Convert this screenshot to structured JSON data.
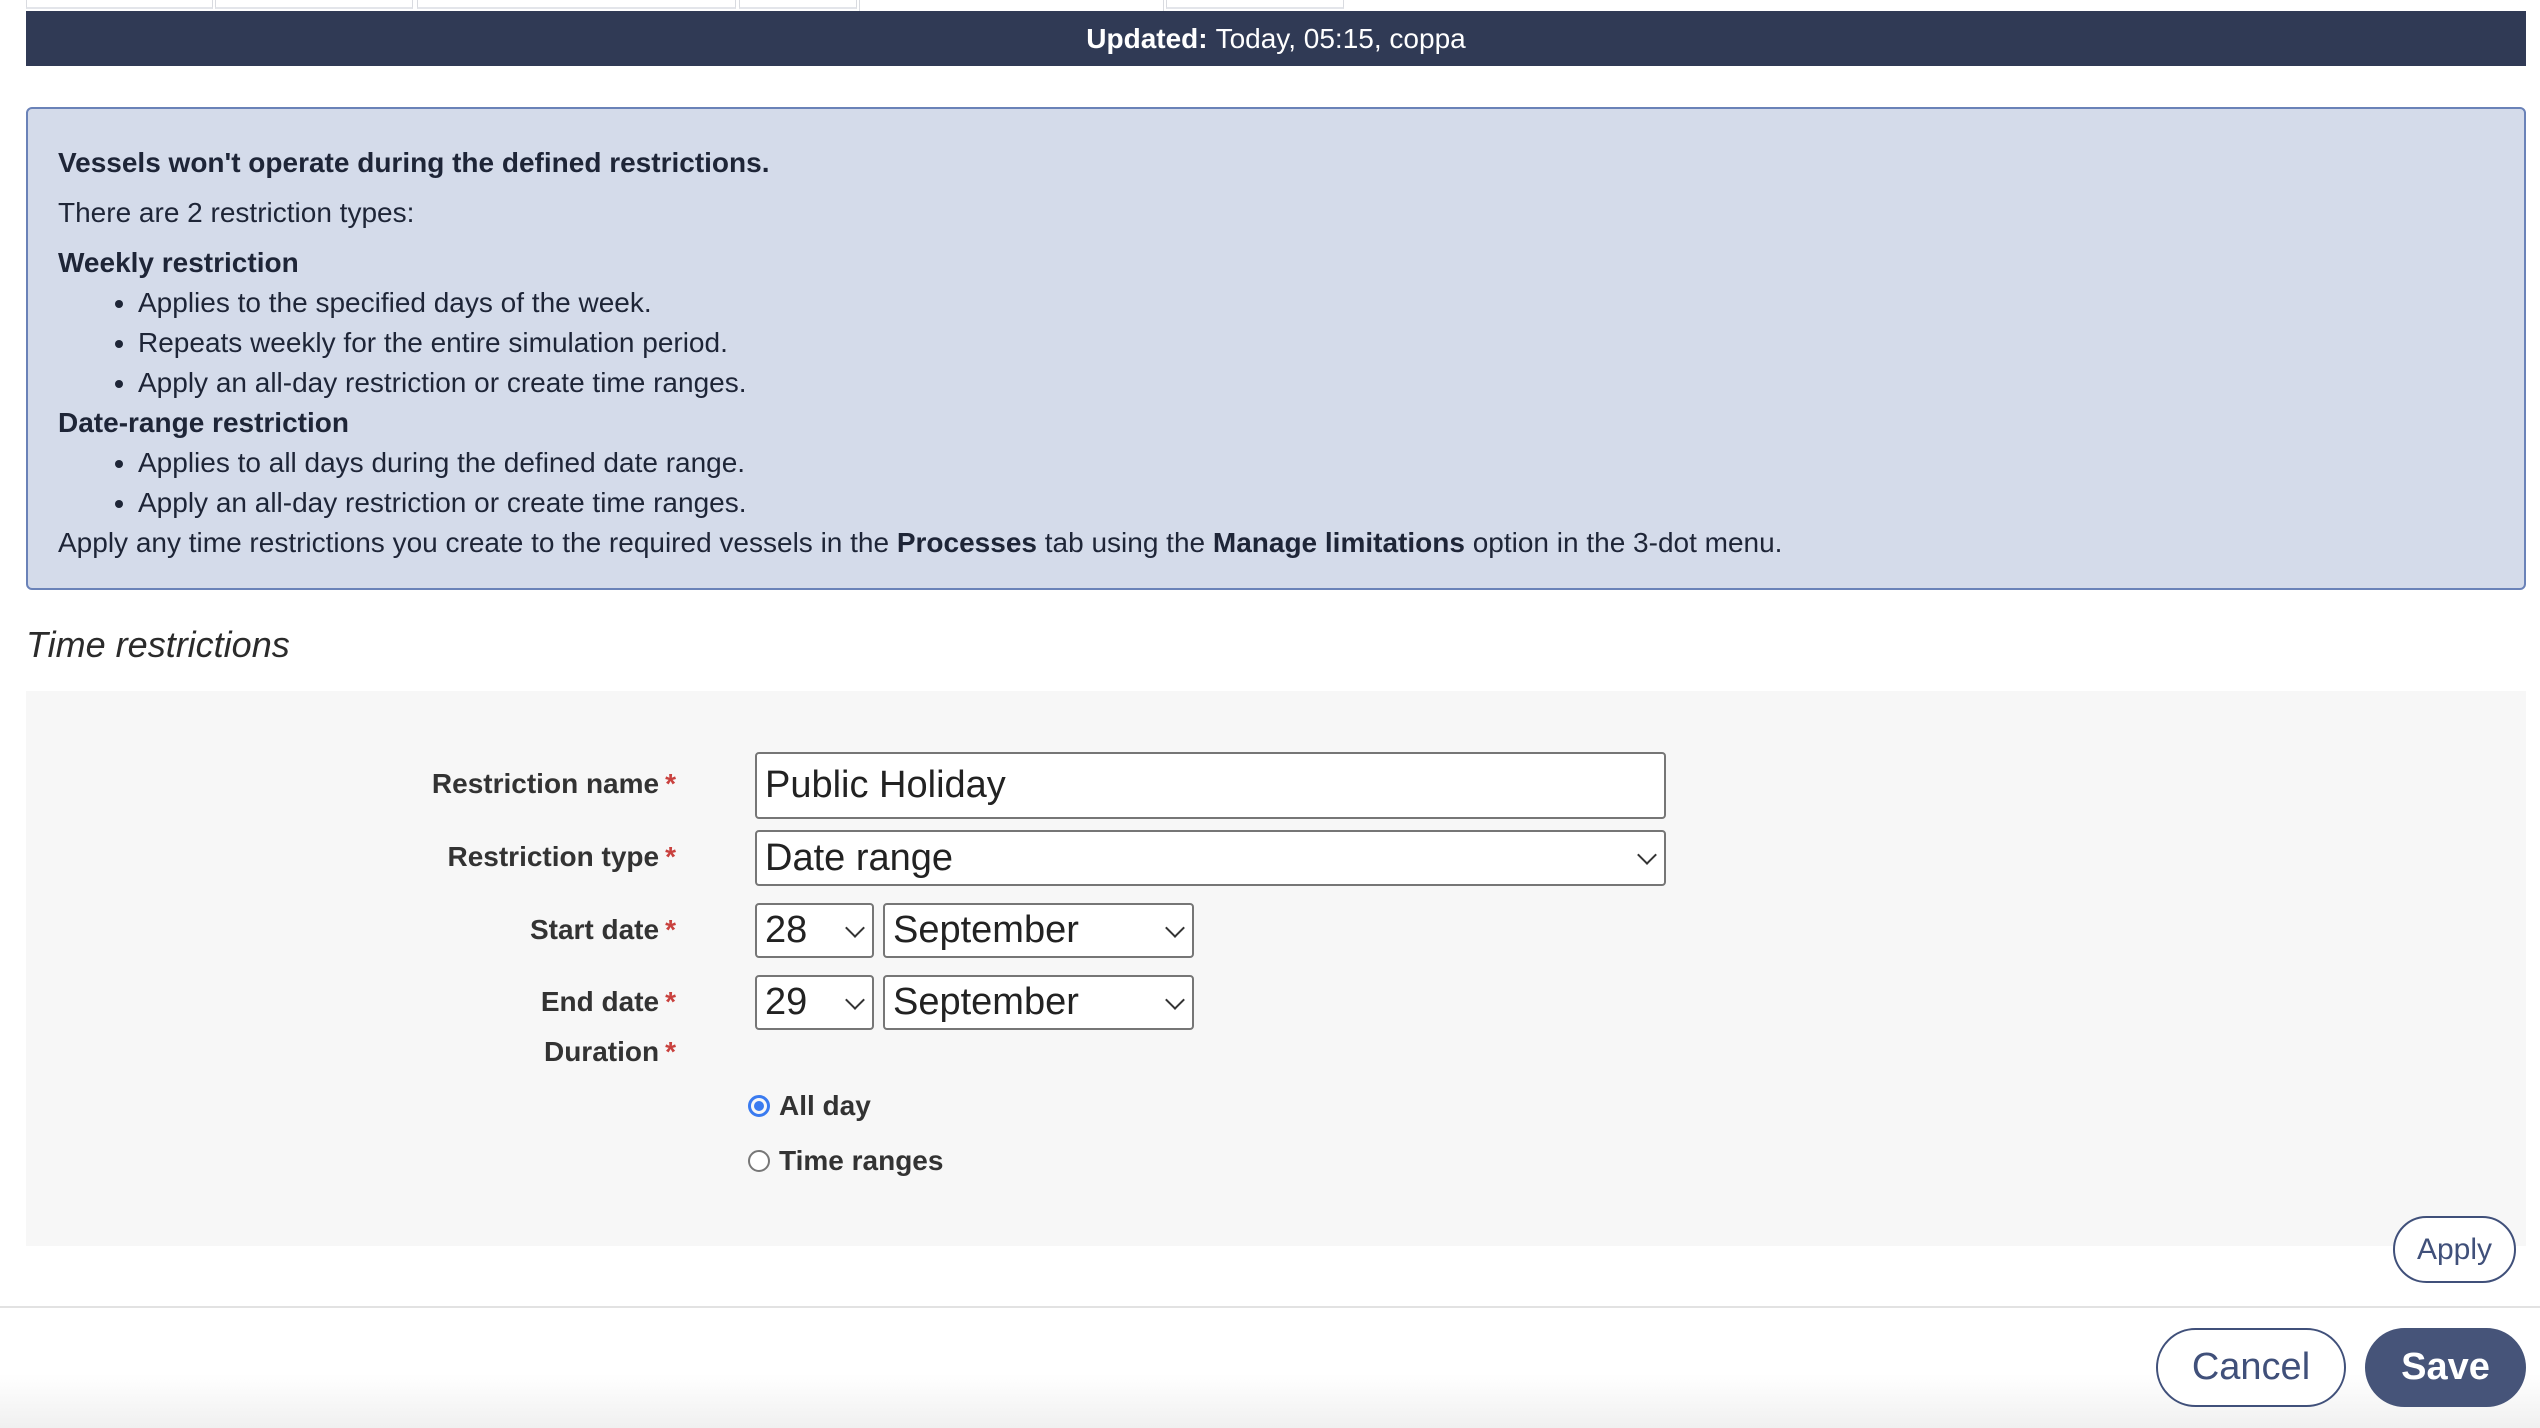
{
  "tabs": [
    {
      "label": "",
      "active": false
    },
    {
      "label": "",
      "active": false
    },
    {
      "label": "",
      "active": false
    },
    {
      "label": "",
      "active": false
    },
    {
      "label": "",
      "active": true
    },
    {
      "label": "",
      "active": false
    }
  ],
  "header": {
    "updated_label": "Updated:",
    "updated_value": "Today, 05:15, coppa"
  },
  "info": {
    "lead": "Vessels won't operate during the defined restrictions.",
    "intro": "There are 2 restriction types:",
    "sections": [
      {
        "title": "Weekly restriction",
        "bullets": [
          "Applies to the specified days of the week.",
          "Repeats weekly for the entire simulation period.",
          "Apply an all-day restriction or create time ranges."
        ]
      },
      {
        "title": "Date-range restriction",
        "bullets": [
          "Applies to all days during the defined date range.",
          "Apply an all-day restriction or create time ranges."
        ]
      }
    ],
    "footer_parts": {
      "p1": "Apply any time restrictions you create to the required vessels in the ",
      "b1": "Processes",
      "p2": " tab using the ",
      "b2": "Manage limitations",
      "p3": " option in the 3-dot menu."
    }
  },
  "section_title": "Time restrictions",
  "form": {
    "required_mark": "*",
    "name_label": "Restriction name",
    "name_value": "Public Holiday",
    "type_label": "Restriction type",
    "type_value": "Date range",
    "start_label": "Start date",
    "start_day": "28",
    "start_month": "September",
    "end_label": "End date",
    "end_day": "29",
    "end_month": "September",
    "duration_label": "Duration",
    "duration_options": [
      {
        "label": "All day",
        "selected": true
      },
      {
        "label": "Time ranges",
        "selected": false
      }
    ],
    "apply_label": "Apply"
  },
  "footer": {
    "cancel_label": "Cancel",
    "save_label": "Save"
  },
  "colors": {
    "header_bg": "#303a55",
    "info_bg": "#d4dbea",
    "info_border": "#6a82b8",
    "primary": "#465479",
    "required": "#c9413e",
    "radio_selected": "#3a7bf0"
  }
}
